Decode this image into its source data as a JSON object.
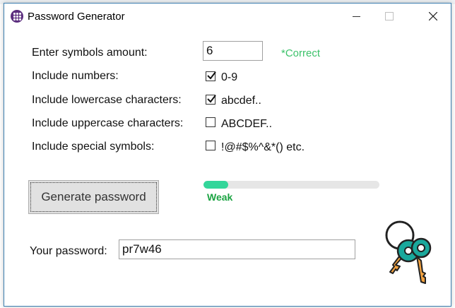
{
  "window": {
    "title": "Password Generator"
  },
  "form": {
    "symbols_amount_label": "Enter symbols amount:",
    "symbols_amount_value": "6",
    "validation_text": "*Correct",
    "include_numbers_label": "Include numbers:",
    "include_numbers_option": "0-9",
    "include_numbers_checked": true,
    "include_lowercase_label": "Include lowercase characters:",
    "include_lowercase_option": "abcdef..",
    "include_lowercase_checked": true,
    "include_uppercase_label": "Include uppercase characters:",
    "include_uppercase_option": "ABCDEF..",
    "include_uppercase_checked": false,
    "include_special_label": "Include special symbols:",
    "include_special_option": "!@#$%^&*() etc.",
    "include_special_checked": false
  },
  "generate": {
    "button_label": "Generate password",
    "strength_text": "Weak",
    "strength_progress": 0.14
  },
  "result": {
    "label": "Your password:",
    "value": "pr7w46"
  },
  "colors": {
    "correct": "#3cc26a",
    "strength_text": "#1aa341",
    "progress_fill": "#33d69a",
    "key_teal": "#1aa89c",
    "key_orange": "#f3a23f"
  },
  "icons": {
    "app": "grid-app-icon",
    "keys": "keys-icon",
    "close": "close-icon"
  }
}
